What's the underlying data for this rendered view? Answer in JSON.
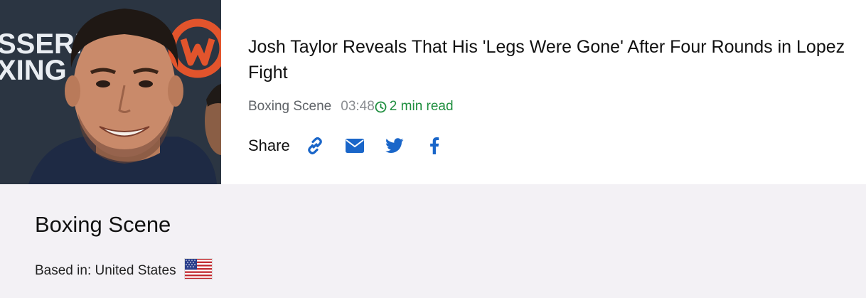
{
  "article": {
    "headline": "Josh Taylor Reveals That His 'Legs Were Gone' After Four Rounds in Lopez Fight",
    "source": "Boxing Scene",
    "time": "03:48",
    "read_time": "2 min read",
    "thumbnail": {
      "backdrop_text_1": "SSERN",
      "backdrop_text_2": "XING"
    }
  },
  "share": {
    "label": "Share",
    "buttons": [
      {
        "name": "copy-link",
        "icon": "link-icon"
      },
      {
        "name": "email",
        "icon": "envelope-icon"
      },
      {
        "name": "twitter",
        "icon": "twitter-icon"
      },
      {
        "name": "facebook",
        "icon": "facebook-icon"
      }
    ],
    "icon_color": "#1a66c9"
  },
  "publisher": {
    "name": "Boxing Scene",
    "based_in_label": "Based in: United States",
    "flag": "us-flag-icon"
  },
  "colors": {
    "read_time": "#1e8e3e",
    "publisher_bg": "#f3f1f5"
  }
}
